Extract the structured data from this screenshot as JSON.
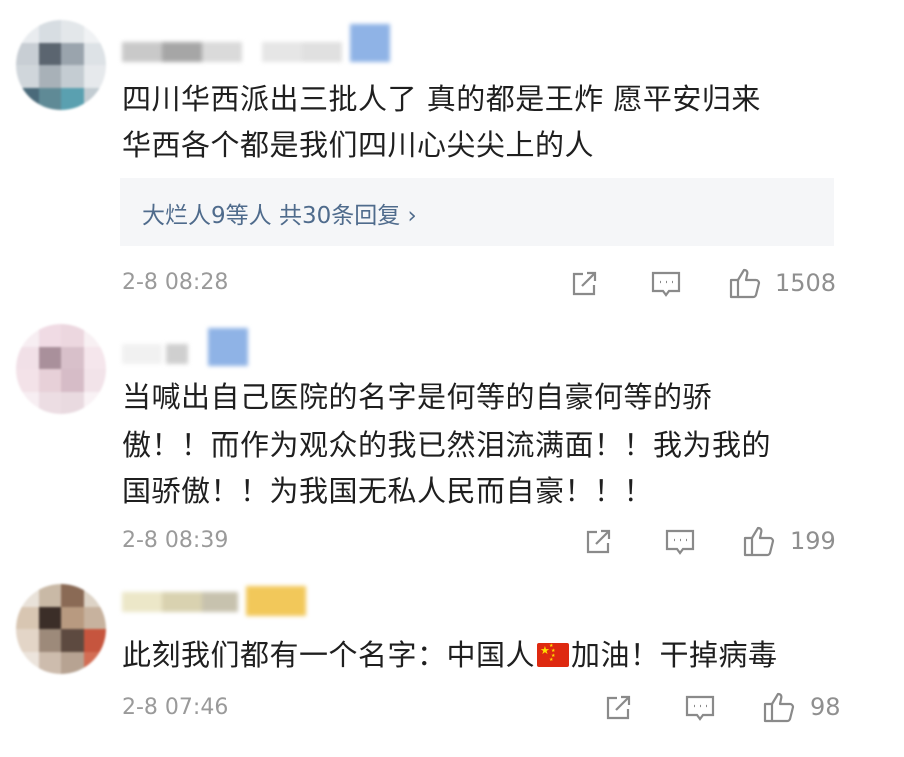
{
  "comments": [
    {
      "text_lines": [
        "四川华西派出三批人了 真的都是王炸 愿平安归来",
        "华西各个都是我们四川心尖尖上的人"
      ],
      "replies_summary": "大烂人9等人  共30条回复 ›",
      "time": "2-8 08:28",
      "likes": "1508"
    },
    {
      "text_lines": [
        "当喊出自己医院的名字是何等的自豪何等的骄",
        "傲！！而作为观众的我已然泪流满面！！我为我的",
        "国骄傲！！为我国无私人民而自豪！！！"
      ],
      "time": "2-8 08:39",
      "likes": "199"
    },
    {
      "text_before_flag": "此刻我们都有一个名字：中国人",
      "text_after_flag": "加油！干掉病毒",
      "time": "2-8 07:46",
      "likes": "98"
    }
  ],
  "icons": {
    "share": "share-icon",
    "comment": "comment-icon",
    "like": "like-icon"
  },
  "colors": {
    "reply_link": "#4f6b8c",
    "meta": "#9a9a9a",
    "flag_red": "#de2910",
    "flag_star": "#ffde00"
  }
}
